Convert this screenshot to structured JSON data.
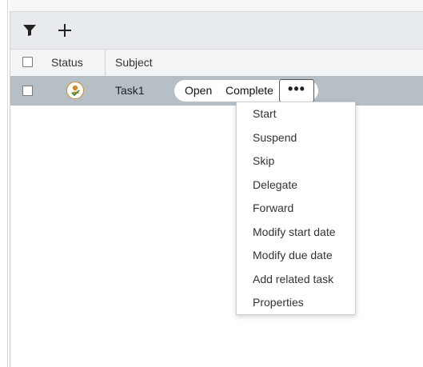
{
  "toolbar": {
    "filter_icon": "filter-icon",
    "add_icon": "plus-icon"
  },
  "table": {
    "columns": [
      "Status",
      "Subject"
    ],
    "rows": [
      {
        "status_icon": "task-status-icon",
        "subject": "Task1"
      }
    ]
  },
  "row_actions": {
    "open_label": "Open",
    "complete_label": "Complete",
    "more_label": "•••"
  },
  "context_menu": {
    "items": [
      "Start",
      "Suspend",
      "Skip",
      "Delegate",
      "Forward",
      "Modify start date",
      "Modify due date",
      "Add related task",
      "Properties"
    ]
  },
  "colors": {
    "toolbar_bg": "#e8ebee",
    "selected_row_bg": "#b6bfc6",
    "status_icon_accent": "#d38b2a",
    "status_icon_check": "#3a8a3a"
  }
}
